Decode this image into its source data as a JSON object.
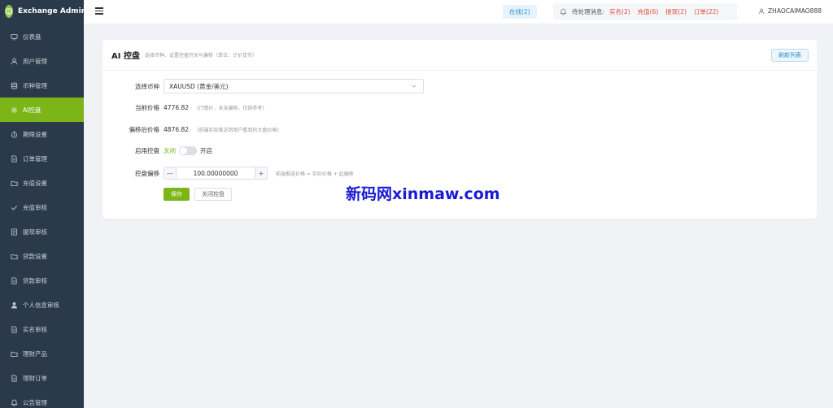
{
  "app": {
    "title": "Exchange Admin"
  },
  "sidebar": {
    "items": [
      {
        "label": "仪表盘",
        "icon": "dashboard-icon"
      },
      {
        "label": "用户管理",
        "icon": "user-icon"
      },
      {
        "label": "币种管理",
        "icon": "database-icon"
      },
      {
        "label": "AI控盘",
        "icon": "gear-icon",
        "active": true
      },
      {
        "label": "期限设置",
        "icon": "timer-icon"
      },
      {
        "label": "订单管理",
        "icon": "document-icon"
      },
      {
        "label": "充值设置",
        "icon": "folder-icon"
      },
      {
        "label": "充值审核",
        "icon": "check-icon"
      },
      {
        "label": "提现审核",
        "icon": "receipt-icon"
      },
      {
        "label": "贷款设置",
        "icon": "folder-icon"
      },
      {
        "label": "贷款审核",
        "icon": "document-icon"
      },
      {
        "label": "个人信息审核",
        "icon": "person-icon"
      },
      {
        "label": "实名审核",
        "icon": "document-icon"
      },
      {
        "label": "理财产品",
        "icon": "folder-icon"
      },
      {
        "label": "理财订单",
        "icon": "document-icon"
      },
      {
        "label": "公告管理",
        "icon": "bell-icon"
      }
    ]
  },
  "topbar": {
    "online": "在线(2)",
    "pending_label": "待处理消息:",
    "pending_items": [
      "实名(2)",
      "充值(6)",
      "提现(2)",
      "订单(22)"
    ],
    "username": "ZHAOCAIMAO888"
  },
  "card": {
    "title": "AI 控盘",
    "subtitle": "选择币种、设置控盘开关与偏移（单位：计价货币）",
    "refresh_label": "刷新列表"
  },
  "form": {
    "symbol_label": "选择币种",
    "symbol_value": "XAUUSD (黄金/美元)",
    "current_price_label": "当前价格",
    "current_price_value": "4776.82",
    "current_price_hint": "(行情价，未含偏移，仅供参考)",
    "offset_price_label": "偏移后价格",
    "offset_price_value": "4876.82",
    "offset_price_hint": "(前端实际推送到用户看到的大盘价格)",
    "enable_label": "启用控盘",
    "enable_off": "关闭",
    "enable_on": "开启",
    "enabled": false,
    "offset_label": "控盘偏移",
    "offset_value": "100.00000000",
    "offset_hint": "前端推送价格 = 实际价格 + 此偏移",
    "step_minus": "—",
    "step_plus": "+",
    "save_label": "保存",
    "close_label": "关闭控盘"
  },
  "watermark": "新码网xinmaw.com",
  "colors": {
    "sidebar_bg": "#2b3a4a",
    "accent": "#7cb518",
    "link_blue": "#2b8ccf",
    "alert_red": "#e2463b"
  }
}
